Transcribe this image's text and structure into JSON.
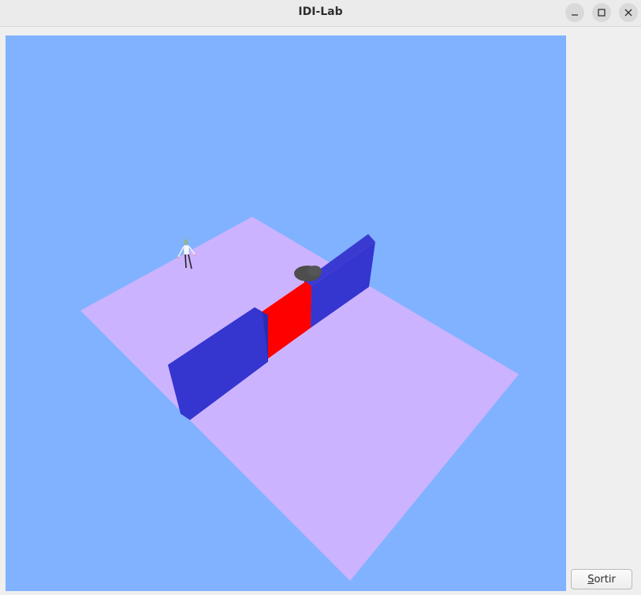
{
  "window": {
    "title": "IDI-Lab",
    "controls": {
      "minimize_icon": "minimize-icon",
      "maximize_icon": "maximize-icon",
      "close_icon": "close-icon"
    }
  },
  "scene": {
    "background_color": "#80b2ff",
    "floor_color": "#ccb3ff",
    "wall_color": "#3333cc",
    "door_color": "#ff0000",
    "rock_color": "#4d4d4d"
  },
  "side_panel": {
    "exit_button": {
      "mnemonic": "S",
      "rest": "ortir"
    }
  }
}
